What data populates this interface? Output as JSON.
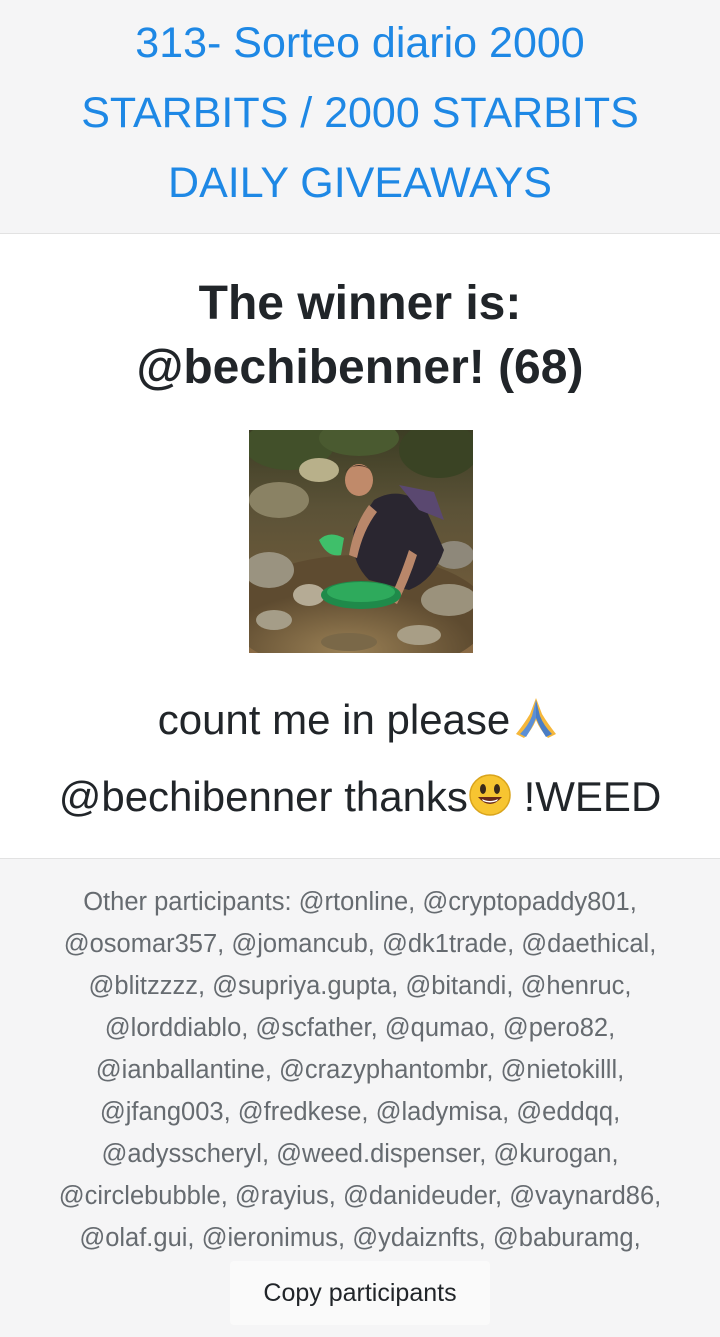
{
  "header": {
    "title": "313- Sorteo diario 2000 STARBITS / 2000 STARBITS DAILY GIVEAWAYS"
  },
  "winner": {
    "line1": "The winner is:",
    "line2": "@bechibenner! (68)"
  },
  "photo": {
    "icon": "winner-avatar-photo"
  },
  "comment": {
    "text1": "count me in please",
    "text2": "@bechibenner thanks",
    "text3": " !WEED",
    "emoji1": "folded-hands-icon",
    "emoji2": "smiley-icon"
  },
  "participants": {
    "text": "Other participants: @rtonline, @cryptopaddy801, @osomar357, @jomancub, @dk1trade, @daethical, @blitzzzz, @supriya.gupta, @bitandi, @henruc, @lorddiablo, @scfather, @qumao, @pero82, @ianballantine, @crazyphantombr, @nietokilll, @jfang003, @fredkese, @ladymisa, @eddqq, @adysscheryl, @weed.dispenser, @kurogan, @circlebubble, @rayius, @danideuder, @vaynard86, @olaf.gui, @ieronimus, @ydaiznfts, @baburamg,"
  },
  "copy_button": {
    "label": "Copy participants"
  },
  "colors": {
    "link": "#1e88e5",
    "text": "#212529",
    "muted": "#666b70",
    "panel": "#f5f5f6"
  }
}
